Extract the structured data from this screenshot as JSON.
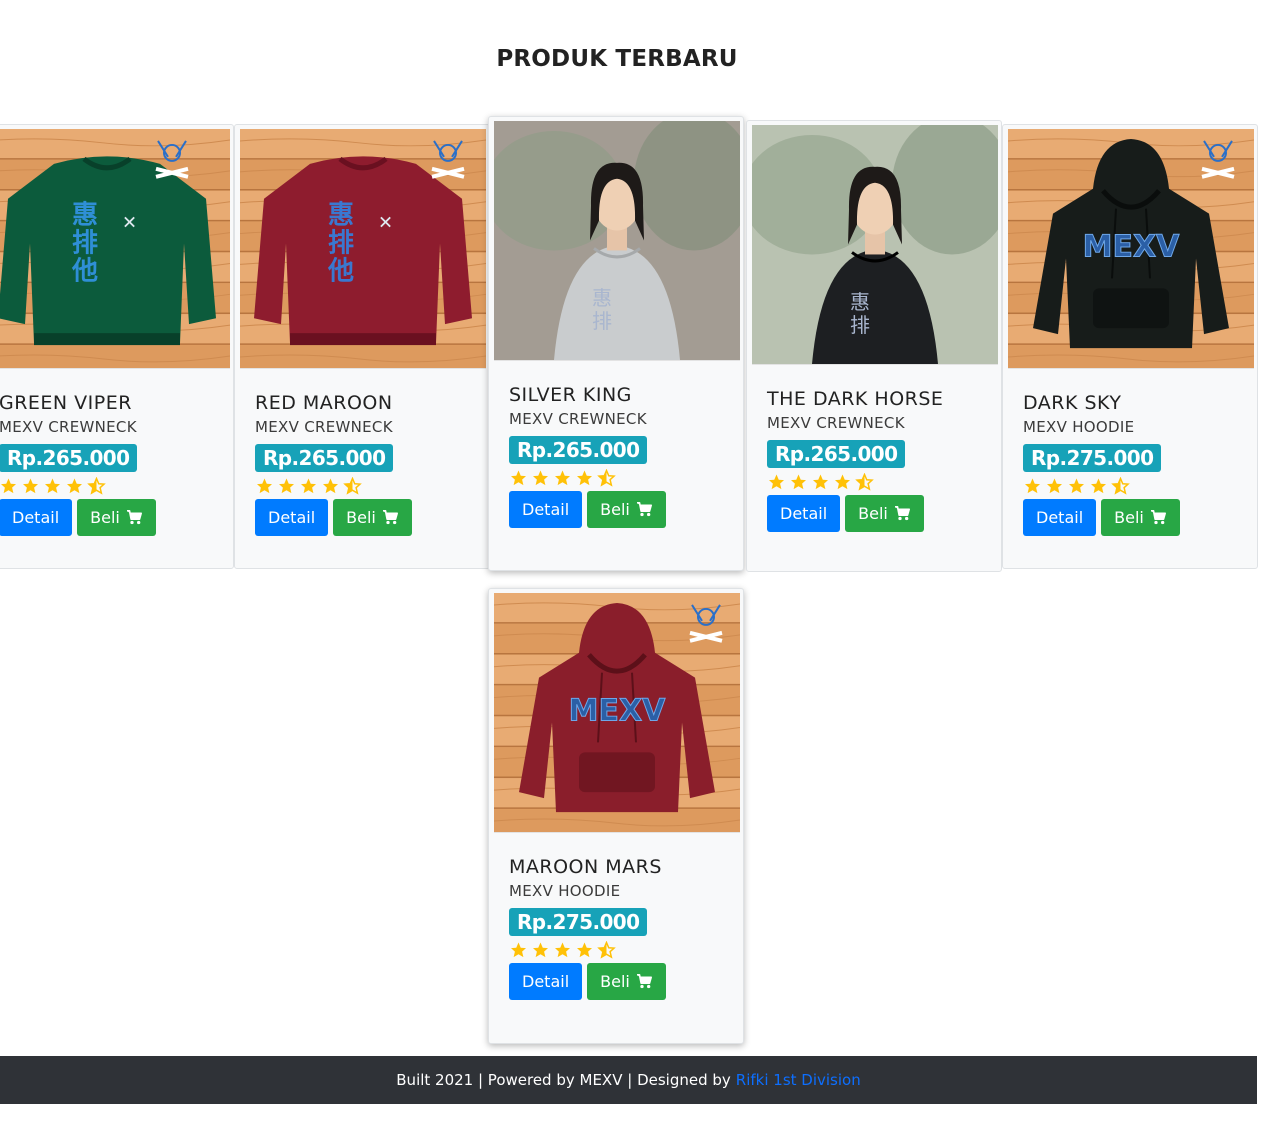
{
  "section": {
    "title": "PRODUK TERBARU"
  },
  "buttons": {
    "detail_label": "Detail",
    "buy_label": "Beli",
    "buy_icon": "cart-icon"
  },
  "rating": {
    "stars": 4.5,
    "max": 5,
    "color": "#ffc107"
  },
  "products": [
    {
      "name": "GREEN VIPER",
      "category": "MEXV CREWNECK",
      "price": "Rp.265.000",
      "image": "green-crewneck"
    },
    {
      "name": "RED MAROON",
      "category": "MEXV CREWNECK",
      "price": "Rp.265.000",
      "image": "maroon-crewneck"
    },
    {
      "name": "SILVER KING",
      "category": "MEXV CREWNECK",
      "price": "Rp.265.000",
      "image": "model-grey-crewneck"
    },
    {
      "name": "THE DARK HORSE",
      "category": "MEXV CREWNECK",
      "price": "Rp.265.000",
      "image": "model-black-crewneck"
    },
    {
      "name": "DARK SKY",
      "category": "MEXV HOODIE",
      "price": "Rp.275.000",
      "image": "dark-hoodie"
    },
    {
      "name": "MAROON MARS",
      "category": "MEXV HOODIE",
      "price": "Rp.275.000",
      "image": "maroon-hoodie"
    }
  ],
  "footer": {
    "text": "Built 2021 | Powered by MEXV | Designed by",
    "link_text": "Rifki 1st Division"
  },
  "colors": {
    "price_badge": "#17a2b8",
    "detail_button": "#007bff",
    "buy_button": "#28a745",
    "footer_bg": "#2f3237",
    "link": "#0d6efd"
  }
}
